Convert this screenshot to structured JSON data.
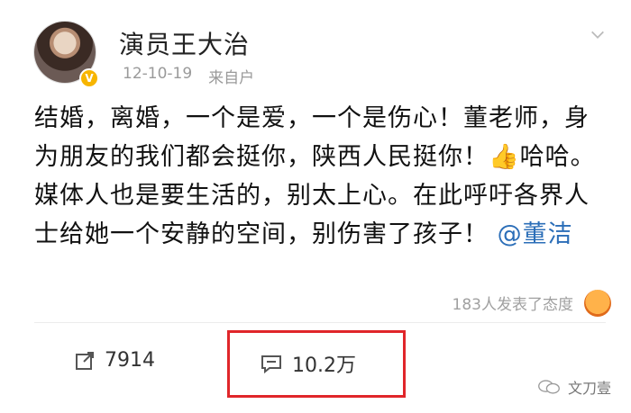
{
  "post": {
    "username": "演员王大治",
    "date": "12-10-19",
    "source": "来自户",
    "text_before_mention": "结婚，离婚，一个是爱，一个是伤心！董老师，身为朋友的我们都会挺你，陕西人民挺你！👍哈哈。媒体人也是要生活的，别太上心。在此呼吁各界人士给她一个安静的空间，别伤害了孩子！",
    "mention": "@董洁",
    "reaction_text": "183人发表了态度"
  },
  "actions": {
    "repost_count": "7914",
    "comment_count": "10.2万"
  },
  "watermark": {
    "text": "文刀壹"
  },
  "colors": {
    "mention": "#2b6eb8",
    "highlight": "#e0262a",
    "verified": "#f7b500"
  },
  "icons": [
    "chevron-down-icon",
    "verified-icon",
    "repost-icon",
    "comment-icon",
    "reaction-emoji-icon",
    "wechat-icon"
  ]
}
